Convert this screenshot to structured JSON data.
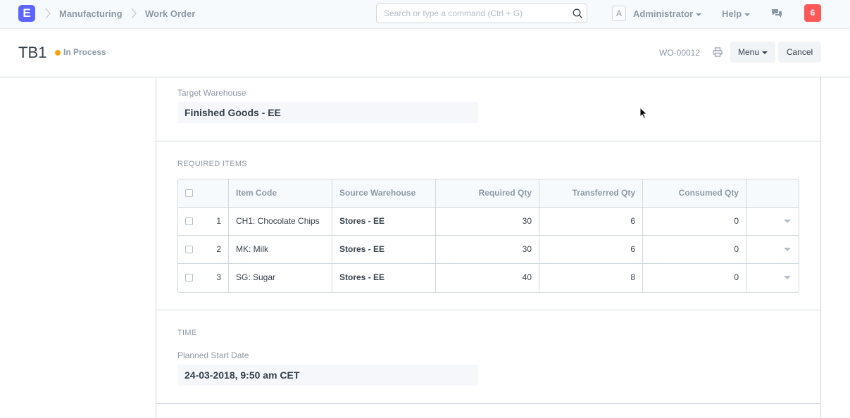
{
  "navbar": {
    "logo_letter": "E",
    "breadcrumbs": [
      "Manufacturing",
      "Work Order"
    ],
    "search_placeholder": "Search or type a command (Ctrl + G)",
    "avatar_letter": "A",
    "user_label": "Administrator",
    "help_label": "Help",
    "notification_count": "6"
  },
  "page_head": {
    "title": "TB1",
    "status": "In Process",
    "status_color": "#ffa00a",
    "doc_name": "WO-00012",
    "menu_label": "Menu",
    "cancel_label": "Cancel"
  },
  "form": {
    "target_warehouse_label": "Target Warehouse",
    "target_warehouse_value": "Finished Goods - EE",
    "required_items_heading": "REQUIRED ITEMS",
    "table": {
      "columns": [
        "Item Code",
        "Source Warehouse",
        "Required Qty",
        "Transferred Qty",
        "Consumed Qty"
      ],
      "rows": [
        {
          "idx": "1",
          "item_code": "CH1: Chocolate Chips",
          "source_warehouse": "Stores - EE",
          "required_qty": "30",
          "transferred_qty": "6",
          "consumed_qty": "0"
        },
        {
          "idx": "2",
          "item_code": "MK: Milk",
          "source_warehouse": "Stores - EE",
          "required_qty": "30",
          "transferred_qty": "6",
          "consumed_qty": "0"
        },
        {
          "idx": "3",
          "item_code": "SG: Sugar",
          "source_warehouse": "Stores - EE",
          "required_qty": "40",
          "transferred_qty": "8",
          "consumed_qty": "0"
        }
      ]
    },
    "time_heading": "TIME",
    "planned_start_label": "Planned Start Date",
    "planned_start_value": "24-03-2018, 9:50 am CET"
  }
}
